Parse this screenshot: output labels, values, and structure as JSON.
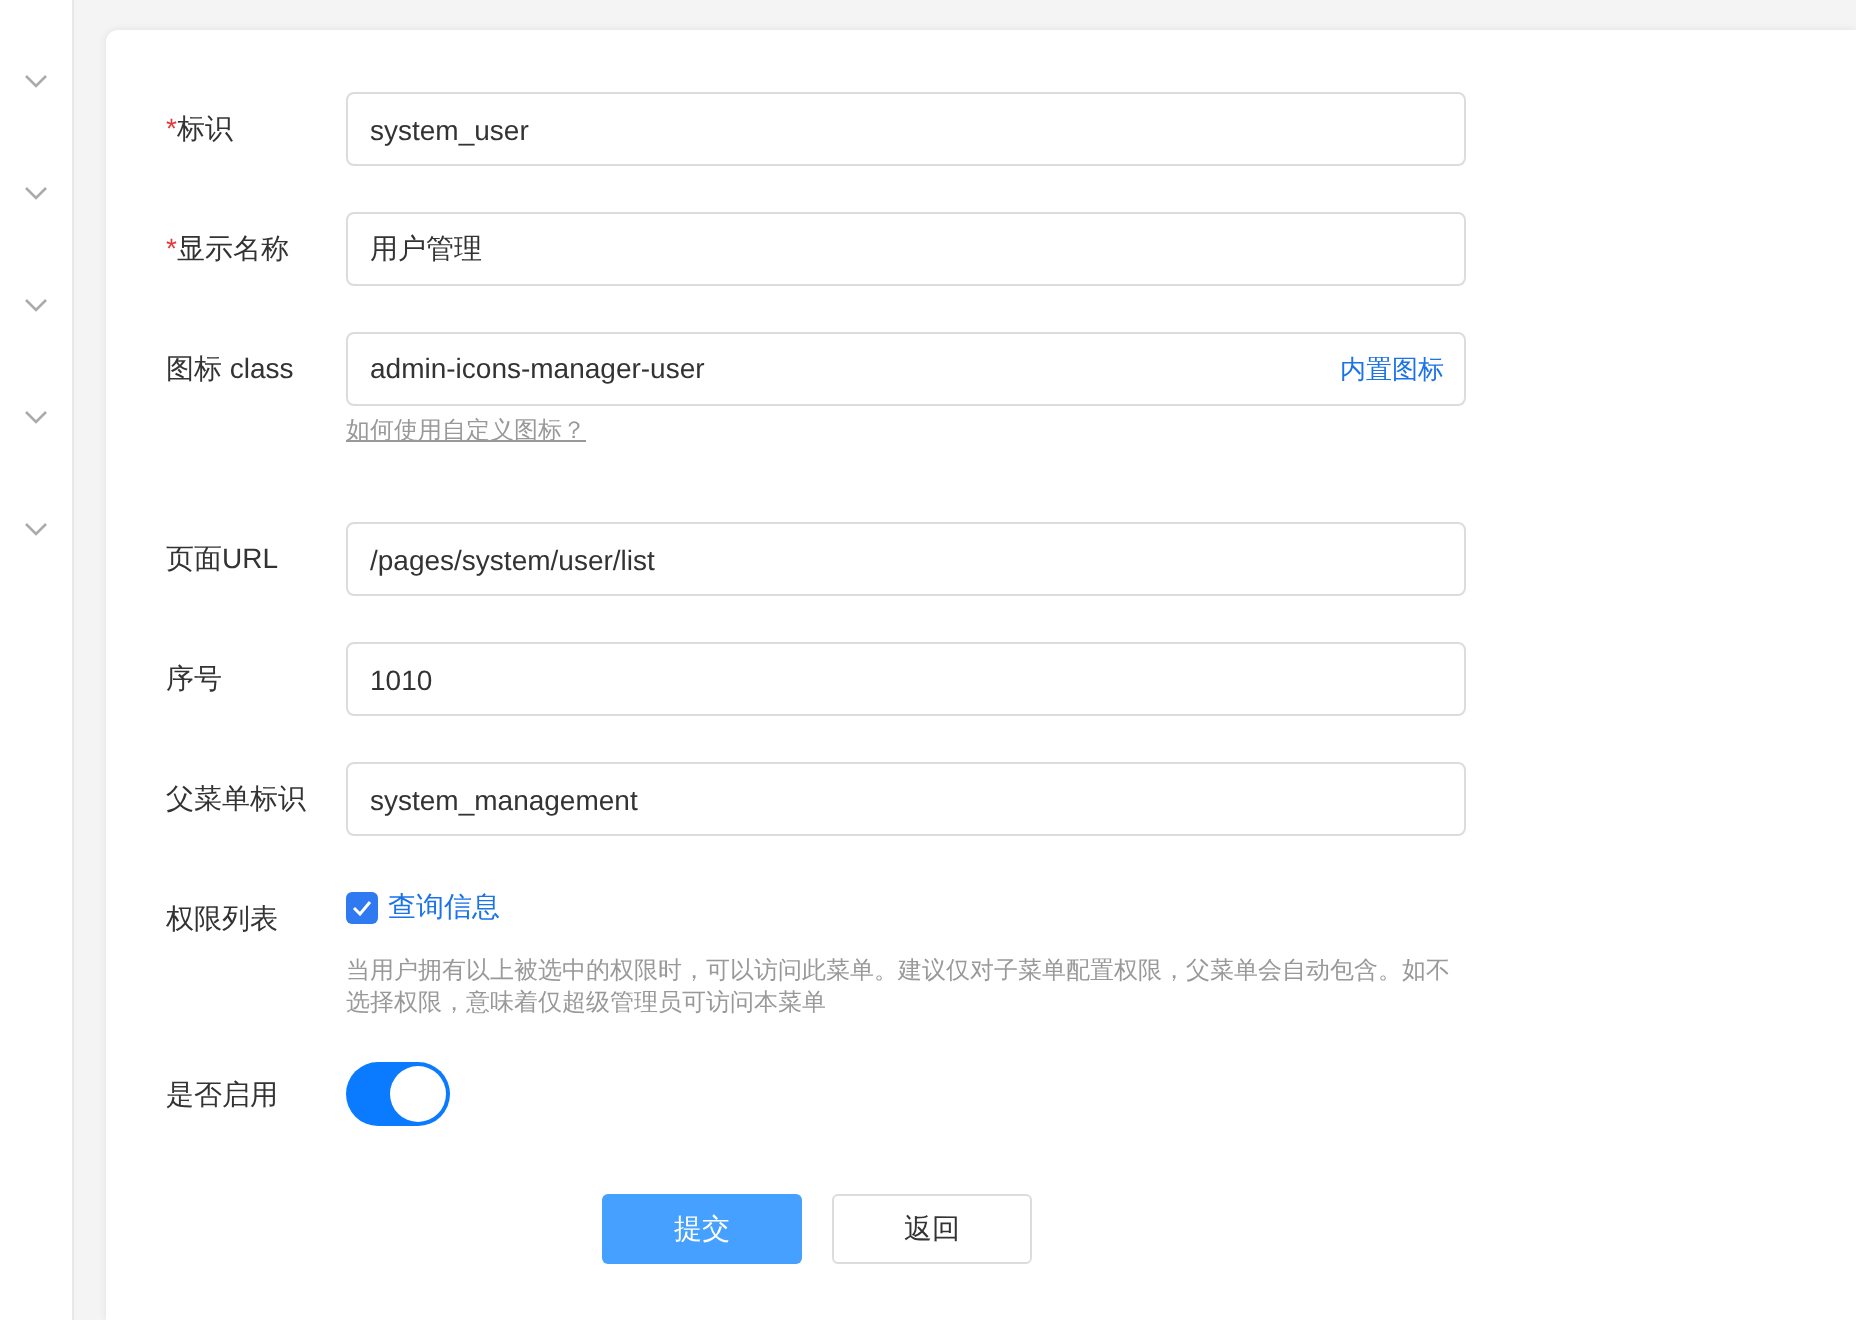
{
  "form": {
    "fields": [
      {
        "kind": "input",
        "label": "标识",
        "required_mark": "*",
        "value": "system_user"
      },
      {
        "kind": "input",
        "label": "显示名称",
        "required_mark": "*",
        "value": "用户管理"
      },
      {
        "kind": "icon",
        "label": "图标 class",
        "value": "admin-icons-manager-user",
        "addon": "内置图标",
        "help_link": "如何使用自定义图标？"
      },
      {
        "kind": "input",
        "label": "页面URL",
        "value": "/pages/system/user/list"
      },
      {
        "kind": "input",
        "label": "序号",
        "value": "1010"
      },
      {
        "kind": "input",
        "label": "父菜单标识",
        "value": "system_management"
      },
      {
        "kind": "permissions",
        "label": "权限列表",
        "options": [
          {
            "label": "查询信息",
            "checked": true
          }
        ],
        "hint": "当用户拥有以上被选中的权限时，可以访问此菜单。建议仅对子菜单配置权限，父菜单会自动包含。如不选择权限，意味着仅超级管理员可访问本菜单"
      },
      {
        "kind": "switch",
        "label": "是否启用",
        "on": true
      }
    ],
    "buttons": [
      {
        "label": "提交",
        "kind": "primary"
      },
      {
        "label": "返回",
        "kind": "default"
      }
    ]
  }
}
